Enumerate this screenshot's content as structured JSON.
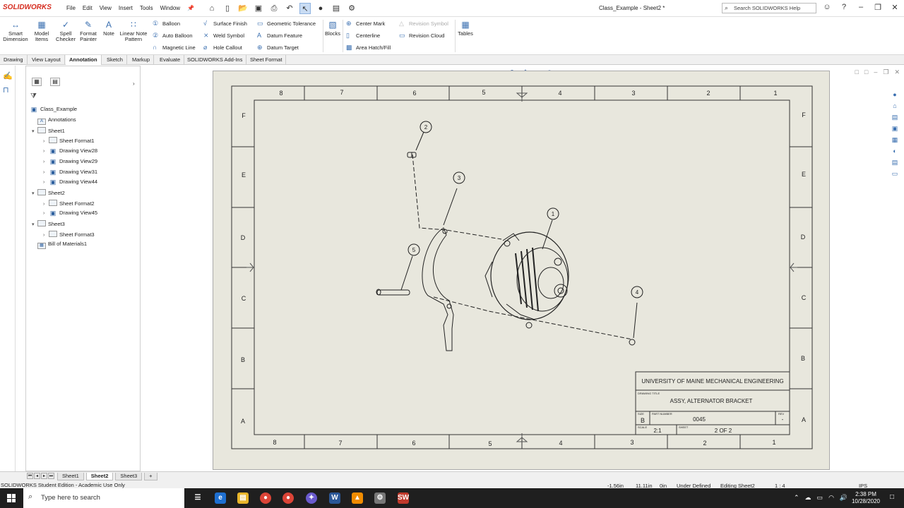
{
  "app": {
    "brand": "SOLIDWORKS",
    "doc_title": "Class_Example - Sheet2 *",
    "menus": [
      "File",
      "Edit",
      "View",
      "Insert",
      "Tools",
      "Window"
    ],
    "search_placeholder": "Search SOLIDWORKS Help"
  },
  "ribbon": {
    "smart_dimension": "Smart Dimension",
    "model_items": "Model Items",
    "spell_checker": "Spell Checker",
    "format_painter": "Format Painter",
    "note": "Note",
    "linear_note_pattern": "Linear Note Pattern",
    "balloon": "Balloon",
    "auto_balloon": "Auto Balloon",
    "magnetic_line": "Magnetic Line",
    "surface_finish": "Surface Finish",
    "weld_symbol": "Weld Symbol",
    "hole_callout": "Hole Callout",
    "geometric_tolerance": "Geometric Tolerance",
    "datum_feature": "Datum Feature",
    "datum_target": "Datum Target",
    "blocks": "Blocks",
    "center_mark": "Center Mark",
    "centerline": "Centerline",
    "area_hatch": "Area Hatch/Fill",
    "revision_symbol": "Revision Symbol",
    "revision_cloud": "Revision Cloud",
    "tables": "Tables"
  },
  "tabs": [
    {
      "label": "Drawing",
      "active": false
    },
    {
      "label": "View Layout",
      "active": false
    },
    {
      "label": "Annotation",
      "active": true
    },
    {
      "label": "Sketch",
      "active": false
    },
    {
      "label": "Markup",
      "active": false
    },
    {
      "label": "Evaluate",
      "active": false
    },
    {
      "label": "SOLIDWORKS Add-Ins",
      "active": false
    },
    {
      "label": "Sheet Format",
      "active": false
    }
  ],
  "tree": {
    "root": "Class_Example",
    "items": [
      {
        "label": "Annotations",
        "depth": 1,
        "expander": "",
        "kind": "annot"
      },
      {
        "label": "Sheet1",
        "depth": 1,
        "expander": "collapse",
        "kind": "sheet"
      },
      {
        "label": "Sheet Format1",
        "depth": 2,
        "expander": "expand",
        "kind": "format"
      },
      {
        "label": "Drawing View28",
        "depth": 2,
        "expander": "expand",
        "kind": "view"
      },
      {
        "label": "Drawing View29",
        "depth": 2,
        "expander": "expand",
        "kind": "view"
      },
      {
        "label": "Drawing View31",
        "depth": 2,
        "expander": "expand",
        "kind": "view"
      },
      {
        "label": "Drawing View44",
        "depth": 2,
        "expander": "expand",
        "kind": "view"
      },
      {
        "label": "Sheet2",
        "depth": 1,
        "expander": "collapse",
        "kind": "sheet"
      },
      {
        "label": "Sheet Format2",
        "depth": 2,
        "expander": "expand",
        "kind": "format"
      },
      {
        "label": "Drawing View45",
        "depth": 2,
        "expander": "expand",
        "kind": "view"
      },
      {
        "label": "Sheet3",
        "depth": 1,
        "expander": "collapse",
        "kind": "sheet"
      },
      {
        "label": "Sheet Format3",
        "depth": 2,
        "expander": "expand",
        "kind": "format"
      },
      {
        "label": "Bill of Materials1",
        "depth": 1,
        "expander": "",
        "kind": "bom"
      }
    ]
  },
  "drawing": {
    "zone_numbers_top": [
      "8",
      "7",
      "6",
      "5",
      "4",
      "3",
      "2",
      "1"
    ],
    "zone_numbers_bottom": [
      "8",
      "7",
      "6",
      "5",
      "4",
      "3",
      "2",
      "1"
    ],
    "zone_letters": [
      "F",
      "E",
      "D",
      "C",
      "B",
      "A"
    ],
    "balloons": [
      "1",
      "2",
      "3",
      "4",
      "5"
    ],
    "title_block": {
      "company": "UNIVERSITY OF MAINE MECHANICAL ENGINEERING",
      "drawing_title_label": "DRAWING TITLE",
      "drawing_title": "ASSY, ALTERNATOR BRACKET",
      "size_label": "SIZE",
      "size": "B",
      "part_number_label": "PART NUMBER",
      "part_number": "0045",
      "rev_label": "REV",
      "rev": "-",
      "scale_label": "SCALE",
      "scale": "2:1",
      "sheet_label": "SHEET",
      "sheet": "2 OF 2"
    }
  },
  "sheet_tabs": [
    {
      "label": "Sheet1",
      "active": false
    },
    {
      "label": "Sheet2",
      "active": true
    },
    {
      "label": "Sheet3",
      "active": false
    }
  ],
  "status": {
    "edition": "SOLIDWORKS Student Edition - Academic Use Only",
    "x": "-1.56in",
    "y": "11.11in",
    "z": "0in",
    "state": "Under Defined",
    "editing": "Editing Sheet2",
    "scale": "1 : 4",
    "units": "IPS"
  },
  "taskbar": {
    "search_placeholder": "Type here to search",
    "time": "2:38 PM",
    "date": "10/28/2020"
  }
}
